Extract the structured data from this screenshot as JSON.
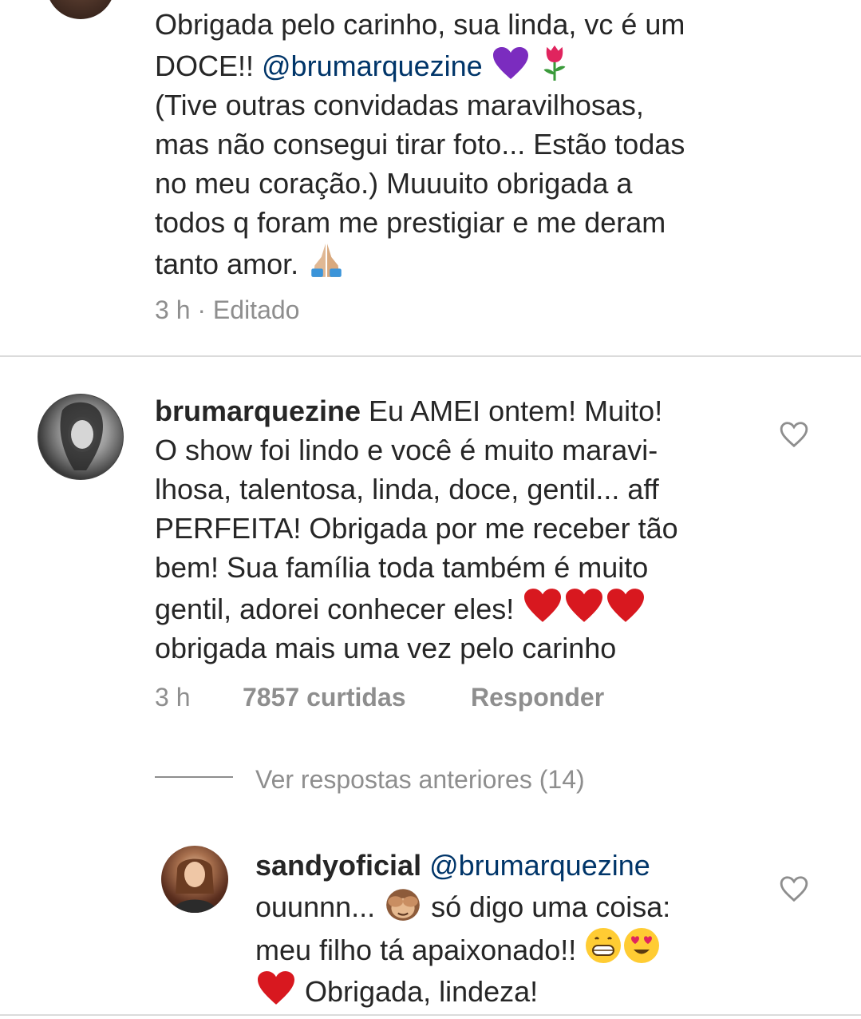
{
  "comment1": {
    "line1": "Obrigada pelo carinho, sua linda, vc é um",
    "line2_prefix": "DOCE!! ",
    "mention": "@brumarquezine",
    "line3": "(Tive outras convidadas maravilhosas,",
    "line4": "mas não consegui tirar foto... Estão todas",
    "line5": "no meu coração.) Muuuito obrigada a",
    "line6": "todos q foram me prestigiar e me deram",
    "line7": "tanto amor. ",
    "time": "3 h",
    "edited": "· Editado",
    "emoji": [
      "purple-heart",
      "tulip",
      "folded-hands"
    ]
  },
  "comment2": {
    "username": "brumarquezine",
    "line1": " Eu AMEI ontem! Muito!",
    "line2": "O show foi lindo e você é muito maravi-",
    "line3": "lhosa, talentosa, linda, doce, gentil... aff",
    "line4": "PERFEITA! Obrigada por me receber tão",
    "line5": "bem! Sua família toda também é muito",
    "line6": "gentil, adorei conhecer eles! ",
    "line7": "obrigada mais uma vez pelo carinho",
    "time": "3 h",
    "likes": "7857 curtidas",
    "reply": "Responder",
    "emoji": [
      "red-heart",
      "red-heart",
      "red-heart"
    ]
  },
  "replies": {
    "label": "Ver respostas anteriores (14)"
  },
  "reply1": {
    "username": "sandyoficial",
    "mention": " @brumarquezine",
    "line2": "ouunnn... ",
    "line2b": "  só digo uma coisa:",
    "line3": "meu filho tá apaixonado!! ",
    "line4": " Obrigada, lindeza!",
    "emoji": [
      "see-no-evil-monkey",
      "grinning-face",
      "heart-eyes",
      "red-heart"
    ]
  },
  "colors": {
    "text": "#262626",
    "secondary": "#8e8e8e",
    "mention": "#003569",
    "divider": "#dbdbdb"
  }
}
